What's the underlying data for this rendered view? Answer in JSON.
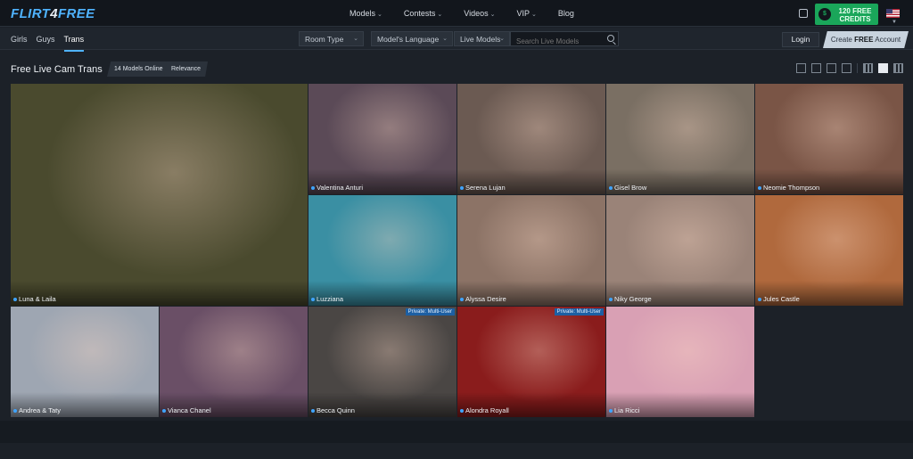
{
  "brand": {
    "logo_a": "FLIRT",
    "logo_b": "4",
    "logo_c": "FREE"
  },
  "main_nav": [
    {
      "label": "Models",
      "caret": "⌄"
    },
    {
      "label": "Contests",
      "caret": "⌄"
    },
    {
      "label": "Videos",
      "caret": "⌄"
    },
    {
      "label": "VIP",
      "caret": "⌄"
    },
    {
      "label": "Blog"
    }
  ],
  "credits": {
    "amount": "120",
    "free": "FREE",
    "unit": "CREDITS"
  },
  "sub_nav": [
    "Girls",
    "Guys",
    "Trans"
  ],
  "filters": {
    "room_type": "Room Type",
    "language": "Model's Language",
    "live": "Live Models"
  },
  "search": {
    "placeholder": "Search Live Models"
  },
  "auth": {
    "login": "Login",
    "create_prefix": "Create",
    "create_free": "FREE",
    "create_suffix": "Account"
  },
  "page": {
    "heading": "Free Live Cam Trans",
    "online_badge": "14 Models Online",
    "sort_badge": "Relevance"
  },
  "models": [
    {
      "name": "Luna & Laila",
      "color": "#4a4a2e",
      "private": ""
    },
    {
      "name": "Valentina Anturi",
      "color": "#5b4a57",
      "private": ""
    },
    {
      "name": "Serena Lujan",
      "color": "#6b5a52",
      "private": ""
    },
    {
      "name": "Gisel Brow",
      "color": "#7a6f63",
      "private": ""
    },
    {
      "name": "Neomie Thompson",
      "color": "#7a5546",
      "private": ""
    },
    {
      "name": "Luzziana",
      "color": "#3a8fa3",
      "private": ""
    },
    {
      "name": "Alyssa Desire",
      "color": "#8c7366",
      "private": ""
    },
    {
      "name": "Niky George",
      "color": "#9a8378",
      "private": ""
    },
    {
      "name": "Jules Castle",
      "color": "#b0693d",
      "private": ""
    },
    {
      "name": "Andrea & Taty",
      "color": "#9ea6b2",
      "private": ""
    },
    {
      "name": "Vianca Chanel",
      "color": "#6a4f66",
      "private": ""
    },
    {
      "name": "Becca Quinn",
      "color": "#4a4644",
      "private": "Private: Multi-User"
    },
    {
      "name": "Alondra Royall",
      "color": "#8a1c1c",
      "private": "Private: Multi-User"
    },
    {
      "name": "Lia Ricci",
      "color": "#d9a0b4",
      "private": ""
    }
  ]
}
